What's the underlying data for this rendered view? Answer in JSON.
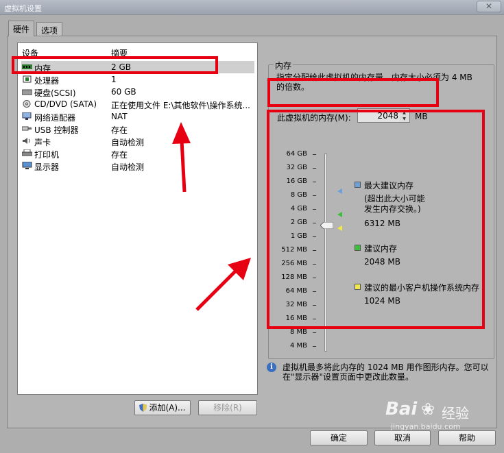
{
  "window": {
    "title": "虚拟机设置",
    "close_icon": "close-icon"
  },
  "tabs": [
    "硬件",
    "选项"
  ],
  "device_list": {
    "col_device": "设备",
    "col_summary": "摘要",
    "items": [
      {
        "name": "内存",
        "summary": "2 GB",
        "icon": "memory-icon"
      },
      {
        "name": "处理器",
        "summary": "1",
        "icon": "cpu-icon"
      },
      {
        "name": "硬盘(SCSI)",
        "summary": "60 GB",
        "icon": "disk-icon"
      },
      {
        "name": "CD/DVD (SATA)",
        "summary": "正在使用文件 E:\\其他软件\\操作系统...",
        "icon": "cdrom-icon"
      },
      {
        "name": "网络适配器",
        "summary": "NAT",
        "icon": "network-icon"
      },
      {
        "name": "USB 控制器",
        "summary": "存在",
        "icon": "usb-icon"
      },
      {
        "name": "声卡",
        "summary": "自动检测",
        "icon": "sound-icon"
      },
      {
        "name": "打印机",
        "summary": "存在",
        "icon": "printer-icon"
      },
      {
        "name": "显示器",
        "summary": "自动检测",
        "icon": "display-icon"
      }
    ],
    "selected_index": 0
  },
  "buttons": {
    "add": "添加(A)...",
    "remove": "移除(R)",
    "ok": "确定",
    "cancel": "取消",
    "help": "帮助"
  },
  "memory": {
    "group_title": "内存",
    "description": "指定分配给此虚拟机的内存量。内存大小必须为 4 MB 的倍数。",
    "field_label": "此虚拟机的内存(M):",
    "field_value": "2048",
    "unit": "MB",
    "scale": [
      "64 GB",
      "32 GB",
      "16 GB",
      "8 GB",
      "4 GB",
      "2 GB",
      "1 GB",
      "512 MB",
      "256 MB",
      "128 MB",
      "64 MB",
      "32 MB",
      "16 MB",
      "8 MB",
      "4 MB"
    ],
    "legend": [
      {
        "label": "最大建议内存",
        "note": "(超出此大小可能\n发生内存交换。)",
        "value": "6312 MB",
        "color": "#6f9fd8"
      },
      {
        "label": "建议内存",
        "value": "2048 MB",
        "color": "#3cbf3c"
      },
      {
        "label": "建议的最小客户机操作系统内存",
        "value": "1024 MB",
        "color": "#f0e84a"
      }
    ]
  },
  "info": {
    "text": "虚拟机最多将此内存的 1024 MB 用作图形内存。您可以在\"显示器\"设置页面中更改此数量。"
  },
  "watermark": {
    "brand": "Bai",
    "brand2": "经验",
    "url": "jingyan.baidu.com"
  },
  "colors": {
    "highlight": "#e60012",
    "arrow": "#e60012"
  }
}
